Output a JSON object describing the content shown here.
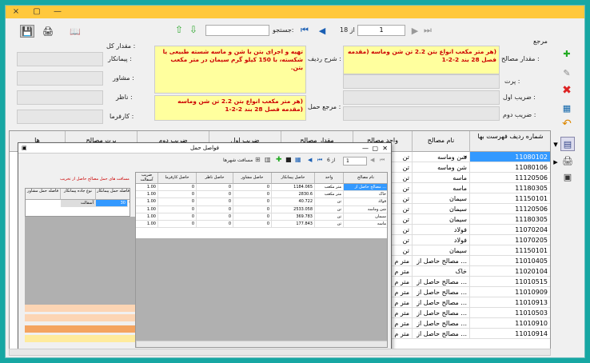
{
  "window": {
    "buttons": {
      "close": "×",
      "maximize": "▢",
      "minimize": "—"
    }
  },
  "toolbar": {
    "search_label": "جستجو:",
    "nav_current": "1",
    "nav_of": "از 18"
  },
  "form": {
    "section_reference": "مرجع",
    "section_total": "مقدار کل :",
    "fields_right": [
      {
        "label": "مقدار مصالح :",
        "value": "(هر متر مکعب انواع بتن 2.2 تن شن وماسه (مقدمه فصل 28 بند 2-2-1",
        "style": "yellow"
      },
      {
        "label": "پرت :",
        "value": "",
        "style": "gray"
      },
      {
        "label": "ضریب اول :",
        "value": "",
        "style": "gray"
      },
      {
        "label": "ضریب دوم :",
        "value": "",
        "style": "gray"
      }
    ],
    "fields_middle": [
      {
        "label": "شرح ردیف :",
        "value": "تهیه و اجرای بتن با شن و ماسه شسته طبیعی یا شکسته، با 150 کیلو گرم سیمان در متر مکعب بتن."
      },
      {
        "label": "مرجع حمل :",
        "value": "(هر متر مکعب انواع بتن 2.2 تن شن وماسه (مقدمه فصل 28 بند 2-2-1"
      }
    ],
    "fields_left": [
      {
        "label": "پیمانکار :"
      },
      {
        "label": "مشاور :"
      },
      {
        "label": "ناظر :"
      },
      {
        "label": "کارفرما :"
      }
    ]
  },
  "main_grid": {
    "columns": [
      "شماره ردیف فهرست بها",
      "نام مصالح",
      "واحد مصالح",
      "مقدار مصالح",
      "ضریب اول",
      "ضریب دوم",
      "پرت مصالح",
      "ها"
    ],
    "rows": [
      {
        "code": "11080102",
        "name": "شن وماسه",
        "unit": "تن",
        "selected": true
      },
      {
        "code": "11080106",
        "name": "شن وماسه",
        "unit": "تن"
      },
      {
        "code": "11120506",
        "name": "ماسه",
        "unit": "تن"
      },
      {
        "code": "11180305",
        "name": "ماسه",
        "unit": "تن"
      },
      {
        "code": "11150101",
        "name": "سیمان",
        "unit": "تن"
      },
      {
        "code": "11120506",
        "name": "سیمان",
        "unit": "تن"
      },
      {
        "code": "11180305",
        "name": "سیمان",
        "unit": "تن"
      },
      {
        "code": "11070204",
        "name": "فولاد",
        "unit": "تن"
      },
      {
        "code": "11070205",
        "name": "فولاد",
        "unit": "تن"
      },
      {
        "code": "11150101",
        "name": "سیمان",
        "unit": "تن"
      },
      {
        "code": "11010405",
        "name": "مصالح حاصل از ...",
        "unit": "متر م"
      },
      {
        "code": "11020104",
        "name": "خاک",
        "unit": "متر م"
      },
      {
        "code": "11010515",
        "name": "مصالح حاصل از ...",
        "unit": "متر م"
      },
      {
        "code": "11010909",
        "name": "مصالح حاصل از ...",
        "unit": "متر م"
      },
      {
        "code": "11010913",
        "name": "مصالح حاصل از ...",
        "unit": "متر م"
      },
      {
        "code": "11010503",
        "name": "مصالح حاصل از ...",
        "unit": "متر م"
      },
      {
        "code": "11010910",
        "name": "مصالح حاصل از ...",
        "unit": "متر م"
      },
      {
        "code": "11010914",
        "name": "مصالح حاصل از ...",
        "unit": "متر م"
      }
    ]
  },
  "dialog": {
    "title": "فواصل حمل",
    "nav_current": "1",
    "nav_of": "از 6",
    "distance_label": "مسافت شهرها",
    "left_caption": "مسافت های حمل مصالح حاصل از تخریب",
    "left_columns": [
      "فاصله حمل پیمانکار",
      "نوع جاده پیمانکار",
      "فاصله حمل مشاور"
    ],
    "left_row": {
      "distance": "30",
      "road": "آسفالت"
    },
    "bands": [
      "30",
      "0",
      "0",
      "0"
    ],
    "columns": [
      "نام مصالح",
      "واحد",
      "حاصل پیمانکار",
      "حاصل مشاور",
      "حاصل ناظر",
      "حاصل کارفرما",
      "ضریب آسفالت"
    ],
    "rows": [
      {
        "name": "مصالح حاصل از ...",
        "unit": "متر مکعب",
        "contractor": "1184.065",
        "consultant": "0",
        "supervisor": "0",
        "employer": "0",
        "coef": "1.00"
      },
      {
        "name": "خاک",
        "unit": "متر مکعب",
        "contractor": "2830.6",
        "consultant": "0",
        "supervisor": "0",
        "employer": "0",
        "coef": "1.00"
      },
      {
        "name": "فولاد",
        "unit": "تن",
        "contractor": "40.722",
        "consultant": "0",
        "supervisor": "0",
        "employer": "0",
        "coef": "1.00"
      },
      {
        "name": "شن وماسه",
        "unit": "تن",
        "contractor": "2533.058",
        "consultant": "0",
        "supervisor": "0",
        "employer": "0",
        "coef": "1.00"
      },
      {
        "name": "سیمان",
        "unit": "تن",
        "contractor": "369.783",
        "consultant": "0",
        "supervisor": "0",
        "employer": "0",
        "coef": "1.00"
      },
      {
        "name": "ماسه",
        "unit": "تن",
        "contractor": "177.843",
        "consultant": "0",
        "supervisor": "0",
        "employer": "0",
        "coef": "1.00"
      }
    ]
  },
  "colors": {
    "titlebar": "#ffc83d",
    "yellow_field": "#ffff9e",
    "selection": "#3399ff",
    "band_peach": "#fcd5b4",
    "band_orange": "#f4a460",
    "band_yellow": "#ffeb9c"
  },
  "icons": [
    "save-icon",
    "print-icon",
    "help-icon",
    "arrow-up-icon",
    "arrow-down-icon",
    "add-icon",
    "edit-icon",
    "delete-icon",
    "calendar-icon",
    "undo-icon",
    "report-icon",
    "calculator-icon"
  ]
}
